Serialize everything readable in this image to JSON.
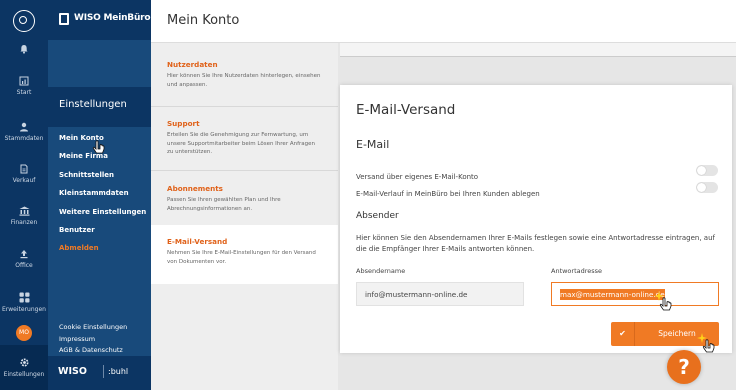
{
  "app": {
    "name": "WISO MeinBüro"
  },
  "rail": {
    "items": [
      {
        "label": "",
        "icon": "bell-icon"
      },
      {
        "label": "Start",
        "icon": "chart-icon"
      },
      {
        "label": "Stammdaten",
        "icon": "user-icon"
      },
      {
        "label": "Verkauf",
        "icon": "document-icon"
      },
      {
        "label": "Finanzen",
        "icon": "bank-icon"
      },
      {
        "label": "Office",
        "icon": "upload-icon"
      },
      {
        "label": "Erweiterungen",
        "icon": "grid-icon"
      },
      {
        "label": "Einstellungen",
        "icon": "gear-icon"
      }
    ],
    "avatar_initials": "MO"
  },
  "nav": {
    "heading": "Einstellungen",
    "items": [
      {
        "label": "Mein Konto",
        "style": "bold"
      },
      {
        "label": "Meine Firma",
        "style": "bold"
      },
      {
        "label": "Schnittstellen",
        "style": "bold"
      },
      {
        "label": "Kleinstammdaten",
        "style": "bold"
      },
      {
        "label": "Weitere Einstellungen",
        "style": "bold"
      },
      {
        "label": "Benutzer",
        "style": "bold"
      },
      {
        "label": "Abmelden",
        "style": "orange"
      }
    ],
    "footer": [
      "Cookie Einstellungen",
      "Impressum",
      "AGB & Datenschutz"
    ],
    "brand_left": "WISO",
    "brand_right": ":buhl"
  },
  "header": {
    "title": "Mein Konto"
  },
  "sections": [
    {
      "title": "Nutzerdaten",
      "desc": "Hier können Sie Ihre Nutzerdaten hinterlegen, einsehen und anpassen."
    },
    {
      "title": "Support",
      "desc": "Erteilen Sie die Genehmigung zur Fernwartung, um unsere Supportmitarbeiter beim Lösen Ihrer Anfragen zu unterstützen."
    },
    {
      "title": "Abonnements",
      "desc": "Passen Sie Ihren gewählten Plan und Ihre Abrechnungsinformationen an."
    },
    {
      "title": "E-Mail-Versand",
      "desc": "Nehmen Sie Ihre E-Mail-Einstellungen für den Versand von Dokumenten vor."
    }
  ],
  "modal": {
    "title": "E-Mail-Versand",
    "email_heading": "E-Mail",
    "toggle_1": "Versand über eigenes E-Mail-Konto",
    "toggle_2": "E-Mail-Verlauf in MeinBüro bei Ihren Kunden ablegen",
    "sender_heading": "Absender",
    "info": "Hier können Sie den Absendernamen Ihrer E-Mails festlegen sowie eine Antwortadresse eintragen, auf die die Empfänger Ihrer E-Mails antworten können.",
    "sender_label": "Absendername",
    "sender_value": "info@mustermann-online.de",
    "reply_label": "Antwortadresse",
    "reply_value": "max@mustermann-online.de",
    "save_label": "Speichern"
  },
  "help": {
    "label": "?"
  },
  "colors": {
    "accent": "#f07a24",
    "navy": "#0c3563",
    "nav_blue": "#184a7b"
  }
}
